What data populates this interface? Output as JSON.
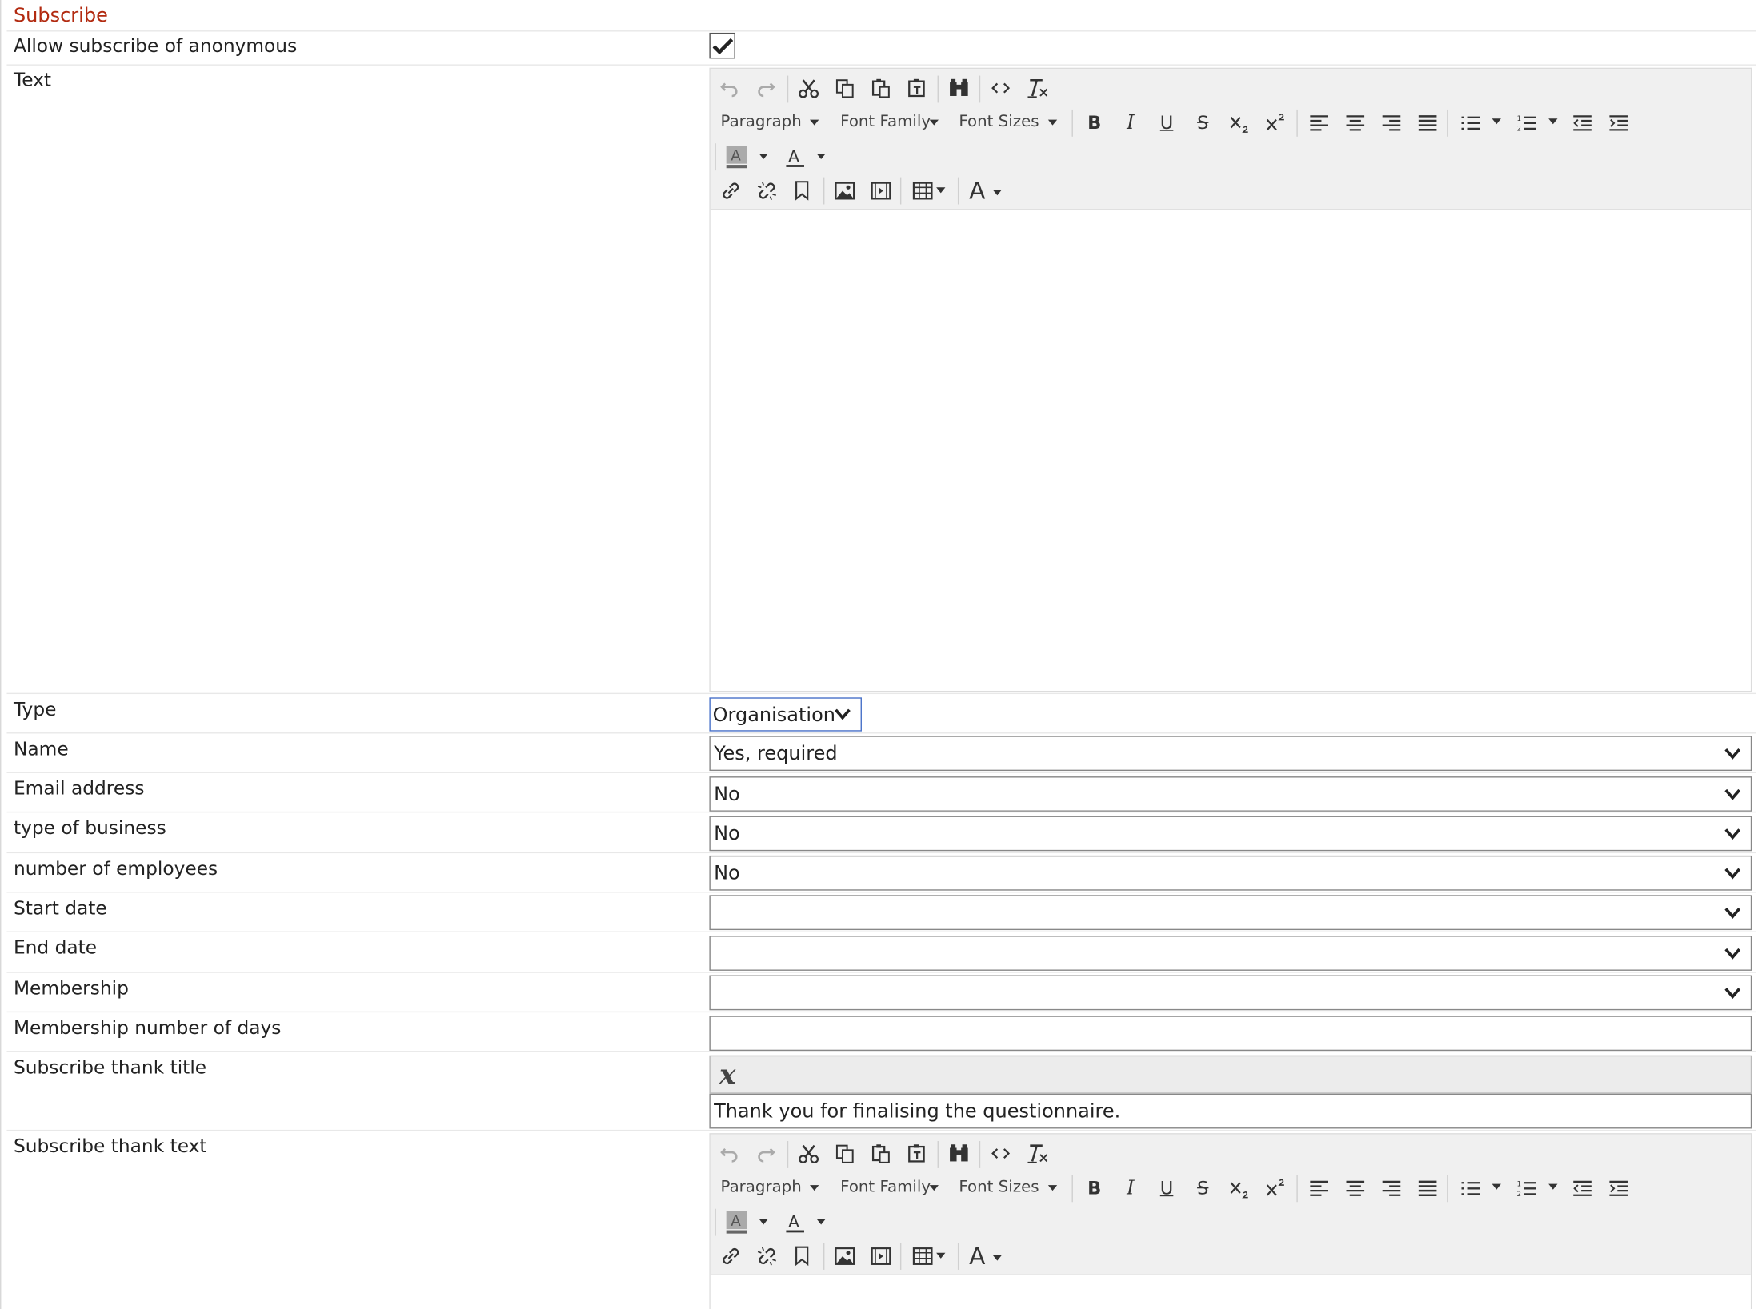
{
  "section": {
    "title": "Subscribe"
  },
  "rows": {
    "allow_anonymous": {
      "label": "Allow subscribe of anonymous",
      "checked": true
    },
    "text": {
      "label": "Text"
    },
    "type": {
      "label": "Type",
      "value": "Organisation"
    },
    "name": {
      "label": "Name",
      "value": "Yes, required"
    },
    "email": {
      "label": "Email address",
      "value": "No"
    },
    "business": {
      "label": "type of business",
      "value": "No"
    },
    "employees": {
      "label": "number of employees",
      "value": "No"
    },
    "start_date": {
      "label": "Start date",
      "value": ""
    },
    "end_date": {
      "label": "End date",
      "value": ""
    },
    "membership": {
      "label": "Membership",
      "value": ""
    },
    "membership_days": {
      "label": "Membership number of days",
      "value": ""
    },
    "thank_title": {
      "label": "Subscribe thank title",
      "value": "Thank you for finalising the questionnaire."
    },
    "thank_text": {
      "label": "Subscribe thank text"
    }
  },
  "toolbar": {
    "format_select": "Paragraph",
    "font_family_select": "Font Family",
    "font_sizes_select": "Font Sizes",
    "bold": "B",
    "italic": "I",
    "underline": "U",
    "strikethrough": "S",
    "text_style": "A",
    "icons": [
      "undo-icon",
      "redo-icon",
      "cut-icon",
      "copy-icon",
      "paste-icon",
      "paste-text-icon",
      "find-replace-icon",
      "source-code-icon",
      "clear-format-icon",
      "subscript-icon",
      "superscript-icon",
      "align-left-icon",
      "align-center-icon",
      "align-right-icon",
      "align-justify-icon",
      "bullet-list-icon",
      "numbered-list-icon",
      "outdent-icon",
      "indent-icon",
      "background-color-icon",
      "text-color-icon",
      "link-icon",
      "unlink-icon",
      "anchor-icon",
      "image-icon",
      "media-icon",
      "table-icon"
    ]
  },
  "colors": {
    "section_title": "#b22a10",
    "toolbar_bg": "#f0f0f0",
    "focus_border": "#4a72c9"
  }
}
